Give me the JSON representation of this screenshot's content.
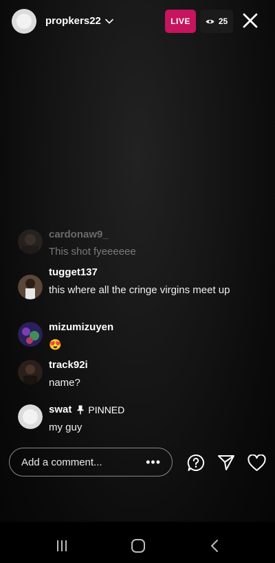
{
  "header": {
    "username": "propkers22",
    "live_label": "LIVE",
    "viewer_count": "25"
  },
  "comments": [
    {
      "username": "cardonaw9_",
      "text": "This shot fyeeeeee"
    },
    {
      "username": "tugget137",
      "text": "this where all the cringe virgins meet up"
    },
    {
      "username": "mizumizuyen",
      "text": "😍"
    },
    {
      "username": "track92i",
      "text": "name?"
    },
    {
      "username": "swat",
      "pinned_label": "PINNED",
      "text": "my guy"
    }
  ],
  "composer": {
    "placeholder": "Add a comment...",
    "more_label": "•••"
  },
  "colors": {
    "live_badge": "#c6145e",
    "background": "#0a0a0a"
  }
}
